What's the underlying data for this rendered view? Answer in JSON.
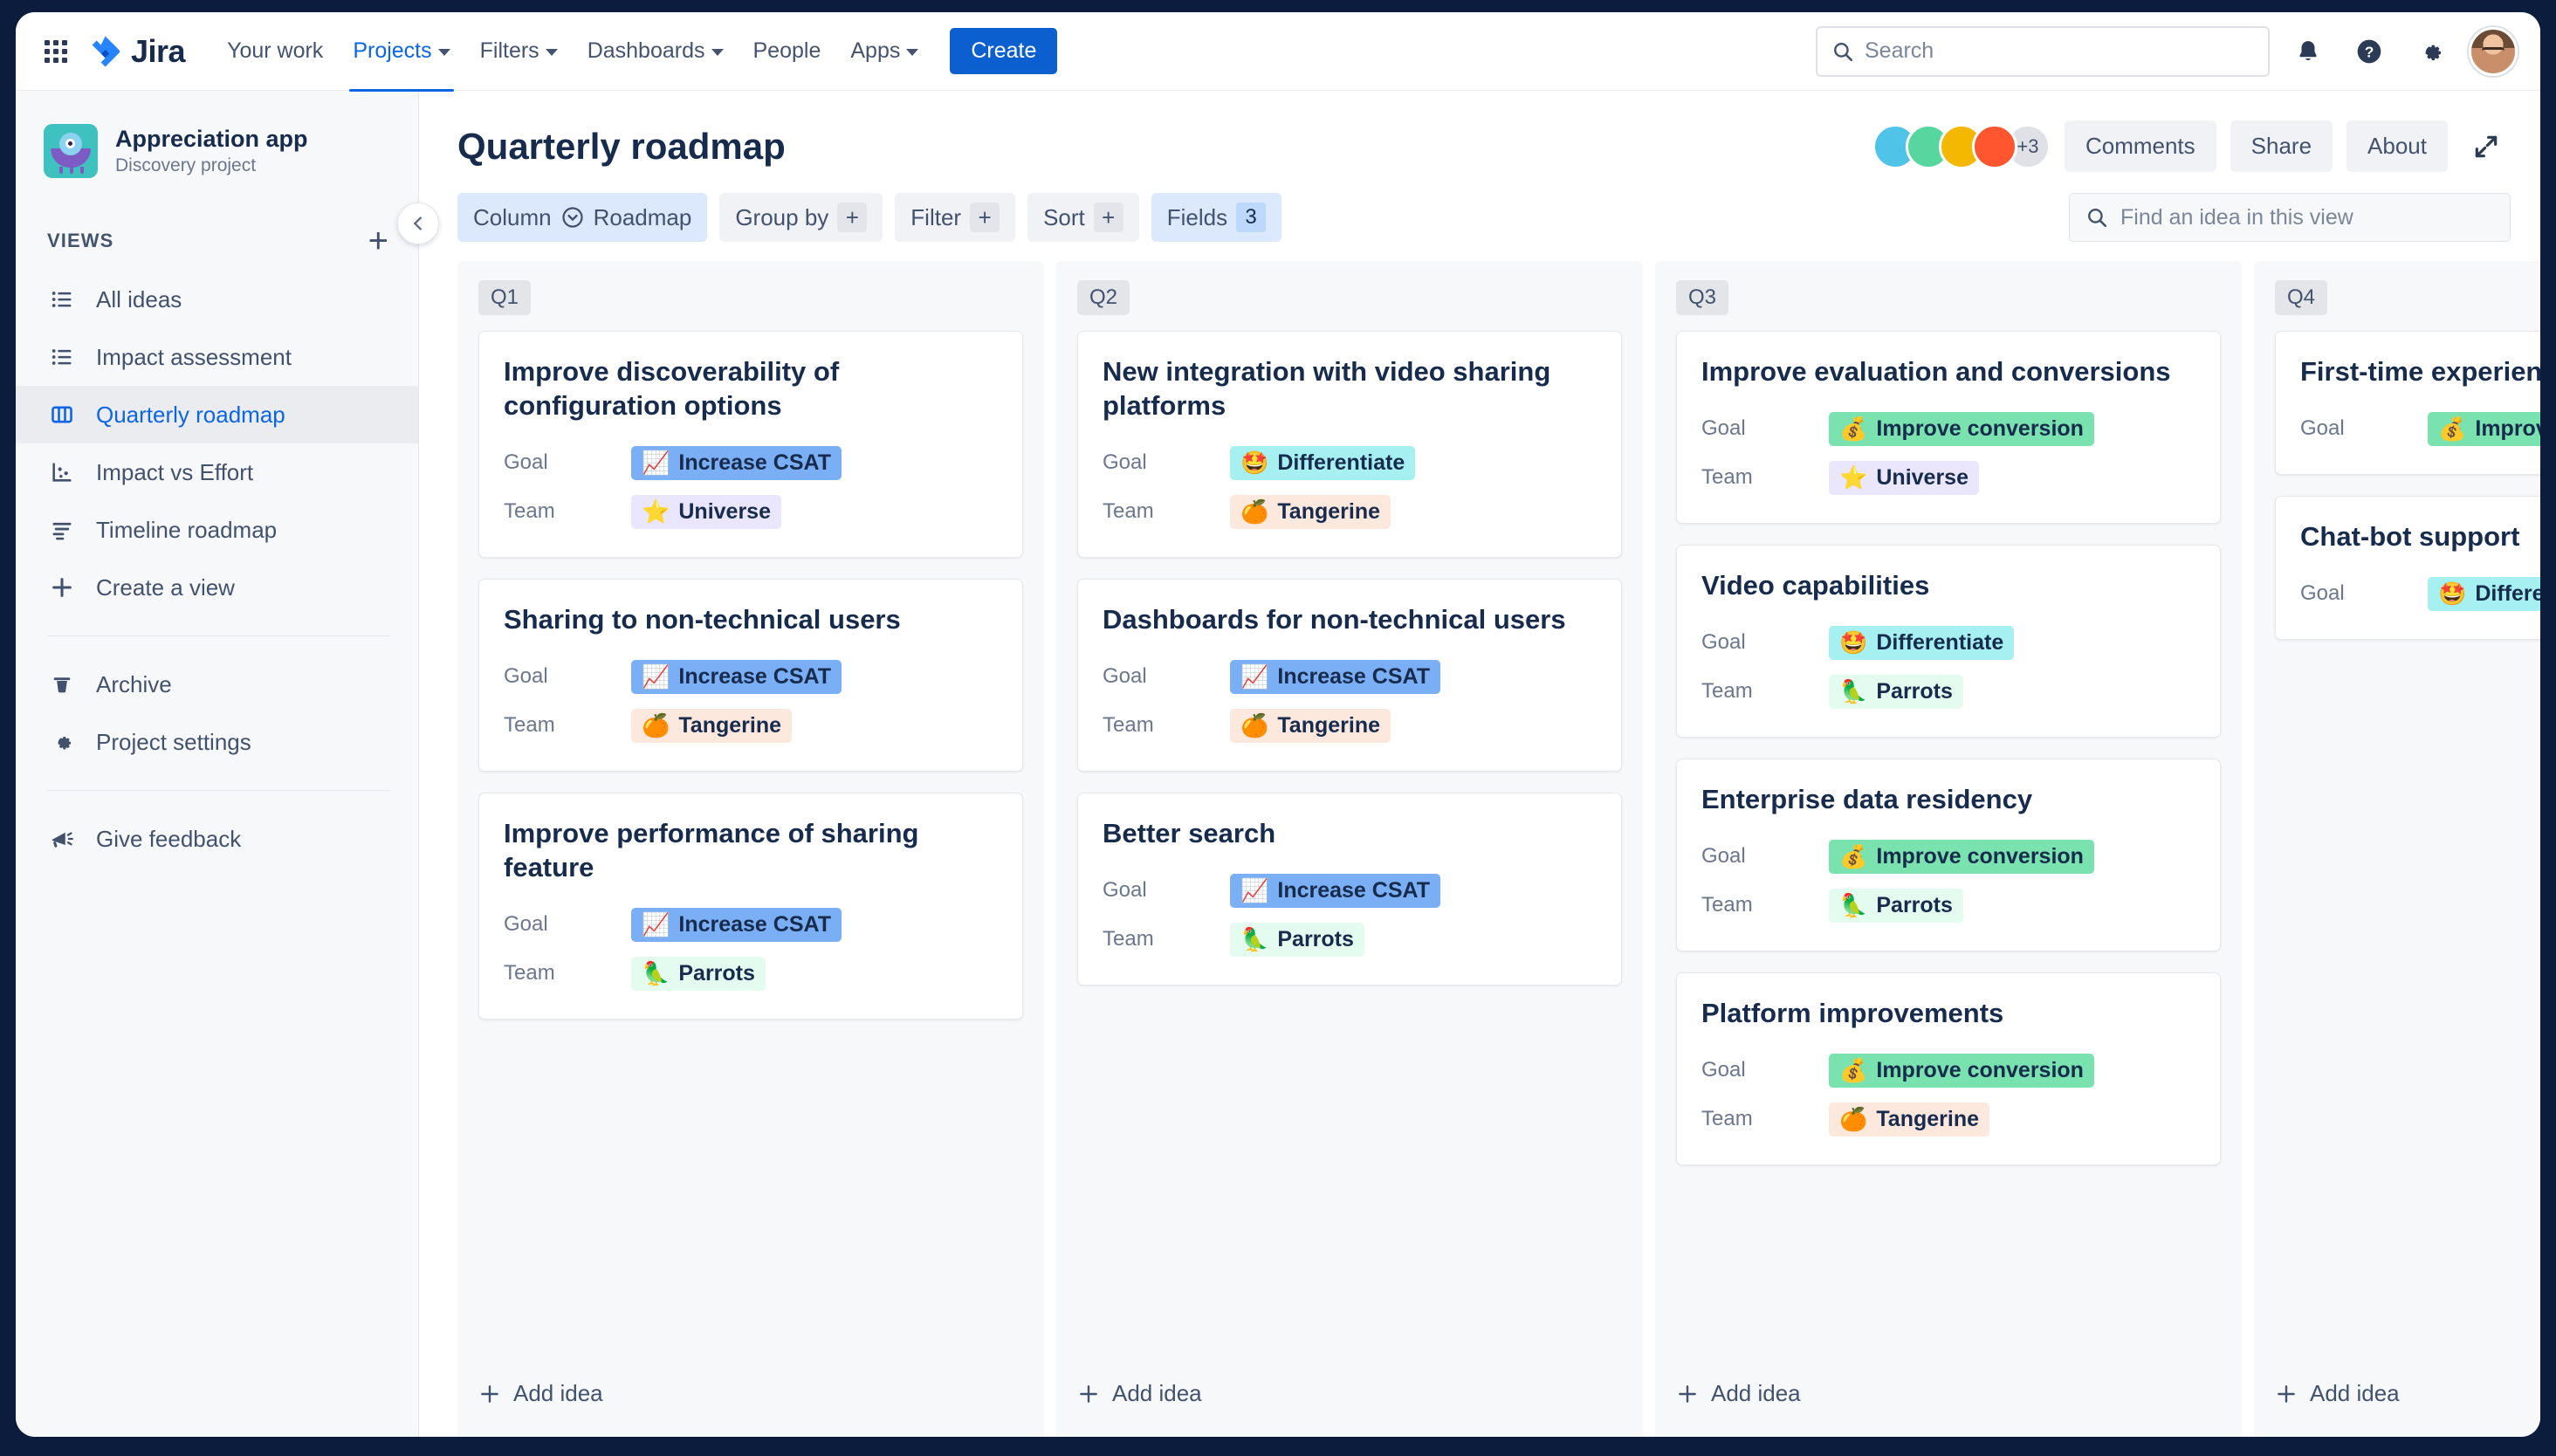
{
  "topnav": {
    "app_switcher_icon": "grid-apps-icon",
    "brand": "Jira",
    "links": [
      {
        "label": "Your work",
        "has_caret": false,
        "active": false
      },
      {
        "label": "Projects",
        "has_caret": true,
        "active": true
      },
      {
        "label": "Filters",
        "has_caret": true,
        "active": false
      },
      {
        "label": "Dashboards",
        "has_caret": true,
        "active": false
      },
      {
        "label": "People",
        "has_caret": false,
        "active": false
      },
      {
        "label": "Apps",
        "has_caret": true,
        "active": false
      }
    ],
    "create_label": "Create",
    "search_placeholder": "Search",
    "icons": [
      "notifications-icon",
      "help-icon",
      "settings-icon",
      "profile-avatar"
    ]
  },
  "sidebar": {
    "project_name": "Appreciation app",
    "project_type": "Discovery project",
    "collapse_icon": "chevron-left-icon",
    "section_label": "VIEWS",
    "add_view_icon": "plus-icon",
    "views": [
      {
        "label": "All ideas",
        "icon": "list-icon",
        "active": false
      },
      {
        "label": "Impact assessment",
        "icon": "list-icon",
        "active": false
      },
      {
        "label": "Quarterly roadmap",
        "icon": "board-columns-icon",
        "active": true
      },
      {
        "label": "Impact vs Effort",
        "icon": "scatter-chart-icon",
        "active": false
      },
      {
        "label": "Timeline roadmap",
        "icon": "timeline-icon",
        "active": false
      },
      {
        "label": "Create a view",
        "icon": "plus-icon",
        "active": false
      }
    ],
    "footer_items": [
      {
        "label": "Archive",
        "icon": "trash-icon"
      },
      {
        "label": "Project settings",
        "icon": "gear-icon"
      }
    ],
    "feedback": {
      "label": "Give feedback",
      "icon": "megaphone-icon"
    }
  },
  "header": {
    "title": "Quarterly roadmap",
    "avatars_overflow": "+3",
    "avatar_colors": [
      "#4fc3e8",
      "#57d6a0",
      "#f5b800",
      "#ff5630"
    ],
    "buttons": [
      "Comments",
      "Share",
      "About"
    ],
    "expand_icon": "expand-icon"
  },
  "toolbar": {
    "column": {
      "label": "Column",
      "value": "Roadmap",
      "icon": "chevron-circle-down-icon",
      "selected": true
    },
    "group_by": {
      "label": "Group by",
      "plus": "+"
    },
    "filter": {
      "label": "Filter",
      "plus": "+"
    },
    "sort": {
      "label": "Sort",
      "plus": "+"
    },
    "fields": {
      "label": "Fields",
      "count": "3",
      "selected": true
    },
    "find_placeholder": "Find an idea in this view",
    "find_icon": "search-icon"
  },
  "board": {
    "add_idea_label": "Add idea",
    "field_labels": {
      "goal": "Goal",
      "team": "Team"
    },
    "tag_styles": {
      "Increase CSAT": {
        "bg": "#7aaef5",
        "emoji": "📈"
      },
      "Differentiate": {
        "bg": "#a6f0f2",
        "emoji": "🤩"
      },
      "Improve conversion": {
        "bg": "#79e2af",
        "emoji": "💰"
      },
      "Universe": {
        "bg": "#eae6fd",
        "emoji": "⭐"
      },
      "Tangerine": {
        "bg": "#fde8de",
        "emoji": "🍊"
      },
      "Parrots": {
        "bg": "#e3fcef",
        "emoji": "🦜"
      }
    },
    "columns": [
      {
        "label": "Q1",
        "cards": [
          {
            "title": "Improve discoverability of configuration options",
            "goal": "Increase CSAT",
            "team": "Universe"
          },
          {
            "title": "Sharing to non-technical users",
            "goal": "Increase CSAT",
            "team": "Tangerine"
          },
          {
            "title": "Improve performance of sharing feature",
            "goal": "Increase CSAT",
            "team": "Parrots"
          }
        ]
      },
      {
        "label": "Q2",
        "cards": [
          {
            "title": "New integration with video sharing platforms",
            "goal": "Differentiate",
            "team": "Tangerine"
          },
          {
            "title": "Dashboards for non-technical users",
            "goal": "Increase CSAT",
            "team": "Tangerine"
          },
          {
            "title": "Better search",
            "goal": "Increase CSAT",
            "team": "Parrots"
          }
        ]
      },
      {
        "label": "Q3",
        "cards": [
          {
            "title": "Improve evaluation and conversions",
            "goal": "Improve conversion",
            "team": "Universe"
          },
          {
            "title": "Video capabilities",
            "goal": "Differentiate",
            "team": "Parrots"
          },
          {
            "title": "Enterprise data residency",
            "goal": "Improve conversion",
            "team": "Parrots"
          },
          {
            "title": "Platform improvements",
            "goal": "Improve conversion",
            "team": "Tangerine"
          }
        ]
      },
      {
        "label": "Q4",
        "cards": [
          {
            "title": "First-time experience",
            "goal": "Improve conversion",
            "team": ""
          },
          {
            "title": "Chat-bot support",
            "goal": "Differentiate",
            "team": ""
          }
        ]
      }
    ]
  }
}
